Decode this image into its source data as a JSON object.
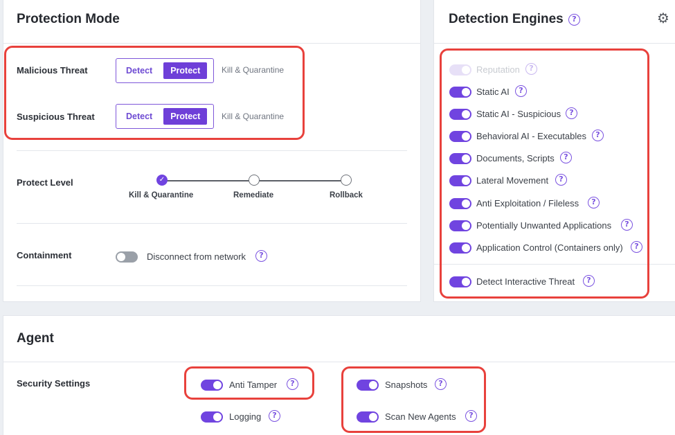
{
  "protection_mode": {
    "title": "Protection Mode",
    "malicious": {
      "label": "Malicious Threat",
      "detect": "Detect",
      "protect": "Protect",
      "action": "Kill & Quarantine"
    },
    "suspicious": {
      "label": "Suspicious Threat",
      "detect": "Detect",
      "protect": "Protect",
      "action": "Kill & Quarantine"
    },
    "protect_level": {
      "label": "Protect Level",
      "options": [
        "Kill & Quarantine",
        "Remediate",
        "Rollback"
      ],
      "selected": "Kill & Quarantine"
    },
    "containment": {
      "label": "Containment",
      "toggle_label": "Disconnect from network",
      "enabled": false
    }
  },
  "detection_engines": {
    "title": "Detection Engines",
    "icons": {
      "help": "?",
      "settings": "gear-icon"
    },
    "engines": [
      {
        "label": "Reputation",
        "enabled": true,
        "disabled": true
      },
      {
        "label": "Static AI",
        "enabled": true
      },
      {
        "label": "Static AI - Suspicious",
        "enabled": true
      },
      {
        "label": "Behavioral AI - Executables",
        "enabled": true
      },
      {
        "label": "Documents, Scripts",
        "enabled": true
      },
      {
        "label": "Lateral Movement",
        "enabled": true
      },
      {
        "label": "Anti Exploitation / Fileless",
        "enabled": true
      },
      {
        "label": "Potentially Unwanted Applications",
        "enabled": true
      },
      {
        "label": "Application Control (Containers only)",
        "enabled": true
      },
      {
        "label": "Detect Interactive Threat",
        "enabled": true
      }
    ]
  },
  "agent": {
    "title": "Agent",
    "security_settings": {
      "label": "Security Settings",
      "anti_tamper": "Anti Tamper",
      "logging": "Logging",
      "snapshots": "Snapshots",
      "scan_new_agents": "Scan New Agents"
    }
  },
  "colors": {
    "accent": "#7044e0",
    "highlight": "#e8413c"
  }
}
